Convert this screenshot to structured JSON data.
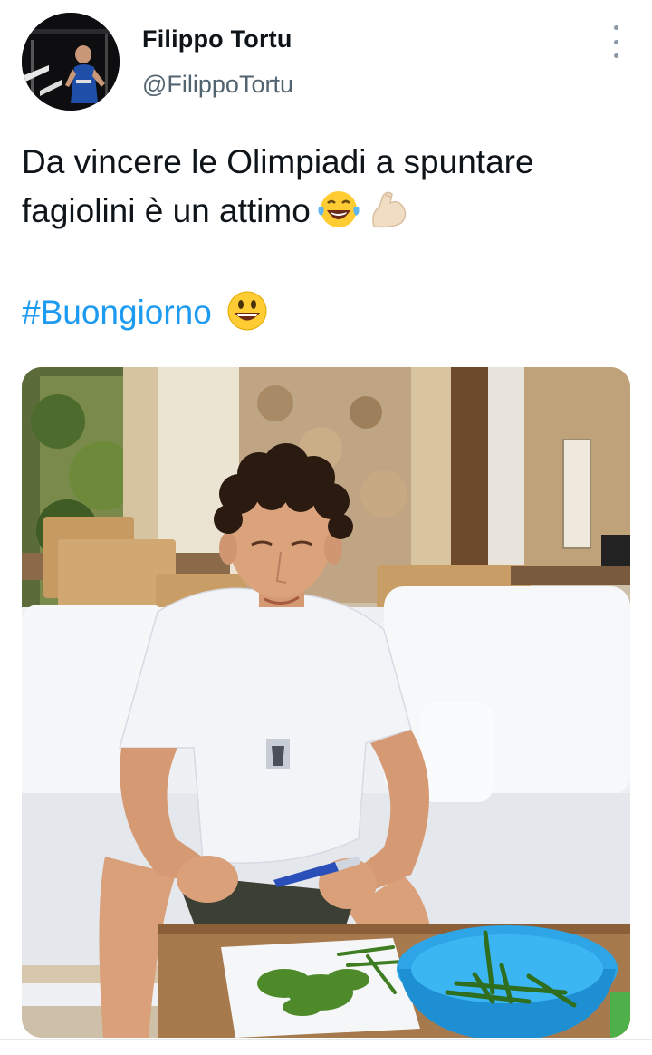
{
  "author": {
    "display_name": "Filippo Tortu",
    "handle": "@FilippoTortu",
    "avatar_icon": "profile-photo"
  },
  "tweet": {
    "text_line_1": "Da vincere le Olimpiadi a spuntare",
    "text_line_2": "fagiolini è un attimo",
    "emoji_1": "face-with-tears-of-joy",
    "emoji_2": "flexed-biceps-light-skin",
    "hashtag": "#Buongiorno",
    "emoji_3": "grinning-face"
  },
  "menu": {
    "icon": "more-vertical-icon"
  },
  "colors": {
    "link": "#1d9bf0",
    "secondary_text": "#536471",
    "primary_text": "#0f1419"
  },
  "media": {
    "type": "photo"
  }
}
